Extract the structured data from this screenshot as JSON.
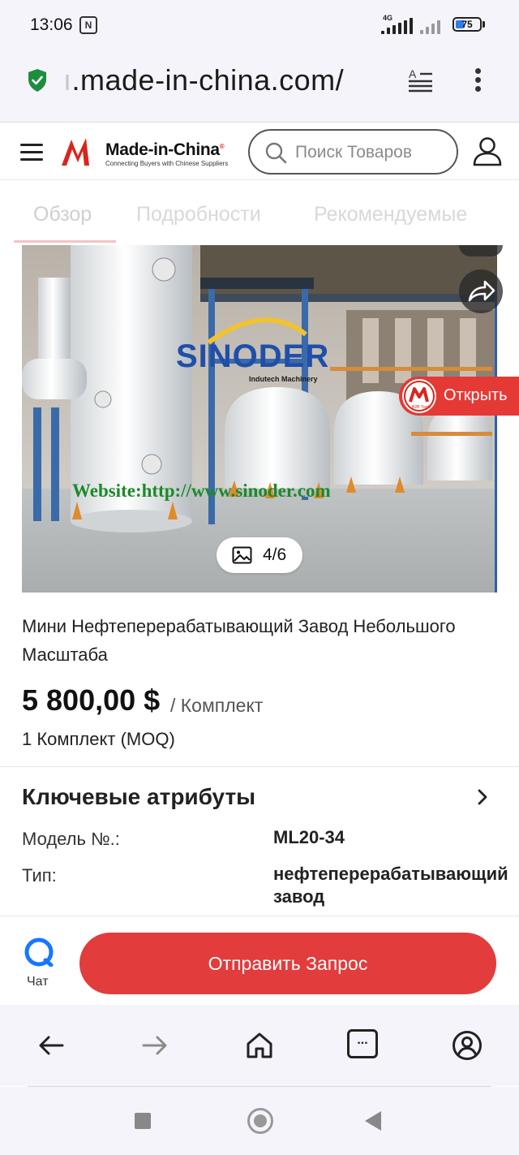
{
  "status_bar": {
    "time": "13:06",
    "nfc_label": "N",
    "network": "4G",
    "battery": "75"
  },
  "browser": {
    "url_faded": "ı",
    "url": ".made-in-china.com/"
  },
  "site": {
    "logo_name": "Made-in-China",
    "logo_tagline": "Connecting Buyers with Chinese Suppliers",
    "logo_registered": "®",
    "search_placeholder": "Поиск Товаров",
    "brand_color": "#d7261e"
  },
  "tabs": [
    {
      "label": "Обзор",
      "active": true
    },
    {
      "label": "Подробности",
      "active": false
    },
    {
      "label": "Рекомендуемые",
      "active": false
    }
  ],
  "gallery": {
    "counter": "4/6",
    "watermark_brand": "SINODER",
    "watermark_sub": "Indutech Machinery",
    "watermark_website": "Website:http://www.sinoder.com",
    "open_badge_text": "Открыть",
    "open_badge_logo_sub": "B2B Trade"
  },
  "product": {
    "title": "Мини Нефтеперерабатывающий Завод Небольшого Масштаба",
    "price": "5 800,00 $",
    "price_unit": "/ Комплект",
    "moq": "1 Комплект (MOQ)"
  },
  "attributes": {
    "title": "Ключевые атрибуты",
    "items": [
      {
        "label": "Модель №.:",
        "value": "ML20-34"
      },
      {
        "label": "Тип:",
        "value": "нефтеперерабатывающий завод"
      }
    ]
  },
  "actions": {
    "chat_label": "Чат",
    "request_label": "Отправить Запрос",
    "request_color": "#e23c3c"
  },
  "browser_nav": {
    "tabs_label": "..."
  }
}
